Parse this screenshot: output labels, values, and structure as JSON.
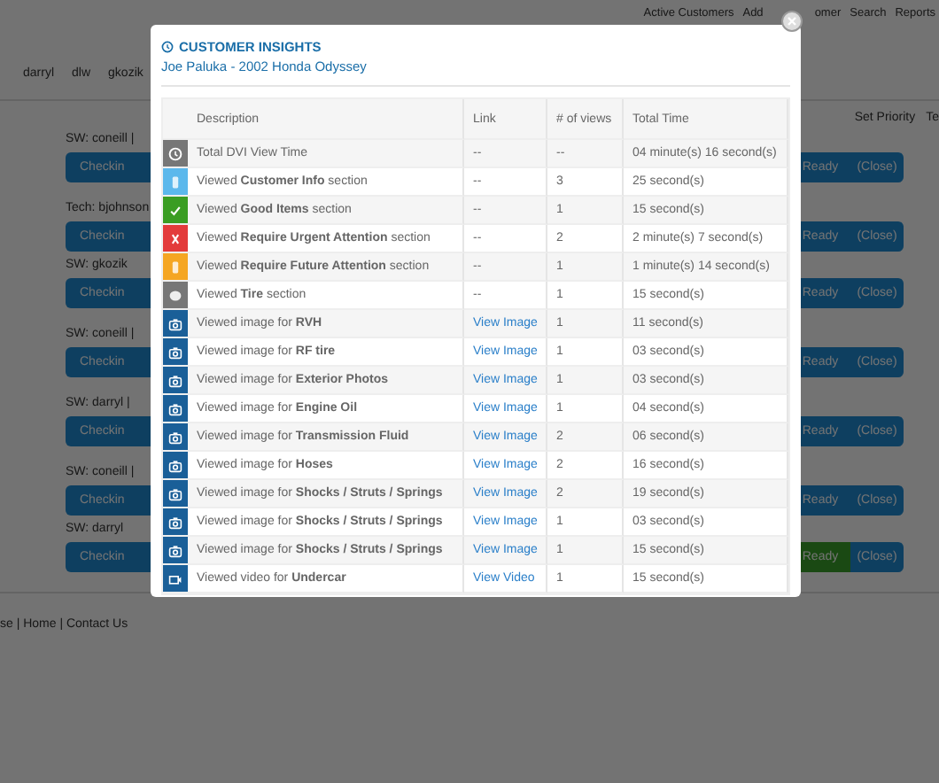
{
  "nav": [
    "Active Customers",
    "Add",
    "omer",
    "Search",
    "Reports"
  ],
  "user_tabs": [
    "darryl",
    "dlw",
    "gkozik"
  ],
  "toolbar": {
    "set_priority": "Set Priority",
    "tech": "Te"
  },
  "groups": [
    {
      "jobs": [
        {
          "label": "SW: coneill |",
          "checkin": "Checkin",
          "ready": "Ready",
          "close": "(Close)",
          "ready_done": false
        }
      ]
    },
    {
      "jobs": [
        {
          "label": "Tech: bjohnson",
          "checkin": "Checkin",
          "ready": "Ready",
          "close": "(Close)",
          "ready_done": false
        },
        {
          "label": "SW: gkozik",
          "checkin": "Checkin",
          "ready": "Ready",
          "close": "(Close)",
          "ready_done": false
        }
      ]
    },
    {
      "jobs": [
        {
          "label": "SW: coneill |",
          "checkin": "Checkin",
          "ready": "Ready",
          "close": "(Close)",
          "ready_done": false
        }
      ]
    },
    {
      "jobs": [
        {
          "label": "SW: darryl |",
          "checkin": "Checkin",
          "ready": "Ready",
          "close": "(Close)",
          "ready_done": false
        }
      ]
    },
    {
      "jobs": [
        {
          "label": "SW: coneill |",
          "checkin": "Checkin",
          "ready": "Ready",
          "close": "(Close)",
          "ready_done": false
        },
        {
          "label": "SW: darryl",
          "checkin": "Checkin",
          "ready": "Ready",
          "close": "(Close)",
          "ready_done": true
        }
      ]
    }
  ],
  "footer": "se | Home | Contact Us",
  "modal": {
    "title": "CUSTOMER INSIGHTS",
    "subtitle": "Joe Paluka - 2002 Honda Odyssey",
    "columns": [
      "Description",
      "Link",
      "# of views",
      "Total Time"
    ],
    "rows": [
      {
        "kind": "clock",
        "description": "Total DVI View Time",
        "link": "--",
        "views": "--",
        "time": "04 minute(s) 16 second(s)"
      },
      {
        "kind": "info",
        "description": "Viewed **Customer Info** section",
        "link": "--",
        "views": "3",
        "time": "25 second(s)"
      },
      {
        "kind": "good",
        "description": "Viewed **Good Items** section",
        "link": "--",
        "views": "1",
        "time": "15 second(s)"
      },
      {
        "kind": "urgent",
        "description": "Viewed **Require Urgent Attention** section",
        "link": "--",
        "views": "2",
        "time": "2 minute(s) 7 second(s)"
      },
      {
        "kind": "future",
        "description": "Viewed **Require Future Attention** section",
        "link": "--",
        "views": "1",
        "time": "1 minute(s) 14 second(s)"
      },
      {
        "kind": "tire",
        "description": "Viewed **Tire** section",
        "link": "--",
        "views": "1",
        "time": "15 second(s)"
      },
      {
        "kind": "image",
        "description": "Viewed image for **RVH**",
        "link": "View Image",
        "views": "1",
        "time": "11 second(s)"
      },
      {
        "kind": "image",
        "description": "Viewed image for **RF tire**",
        "link": "View Image",
        "views": "1",
        "time": "03 second(s)"
      },
      {
        "kind": "image",
        "description": "Viewed image for **Exterior Photos**",
        "link": "View Image",
        "views": "1",
        "time": "03 second(s)"
      },
      {
        "kind": "image",
        "description": "Viewed image for **Engine Oil**",
        "link": "View Image",
        "views": "1",
        "time": "04 second(s)"
      },
      {
        "kind": "image",
        "description": "Viewed image for **Transmission Fluid**",
        "link": "View Image",
        "views": "2",
        "time": "06 second(s)"
      },
      {
        "kind": "image",
        "description": "Viewed image for **Hoses**",
        "link": "View Image",
        "views": "2",
        "time": "16 second(s)"
      },
      {
        "kind": "image",
        "description": "Viewed image for **Shocks / Struts / Springs**",
        "link": "View Image",
        "views": "2",
        "time": "19 second(s)"
      },
      {
        "kind": "image",
        "description": "Viewed image for **Shocks / Struts / Springs**",
        "link": "View Image",
        "views": "1",
        "time": "03 second(s)"
      },
      {
        "kind": "image",
        "description": "Viewed image for **Shocks / Struts / Springs**",
        "link": "View Image",
        "views": "1",
        "time": "15 second(s)"
      },
      {
        "kind": "video",
        "description": "Viewed video for **Undercar**",
        "link": "View Video",
        "views": "1",
        "time": "15 second(s)"
      }
    ]
  }
}
